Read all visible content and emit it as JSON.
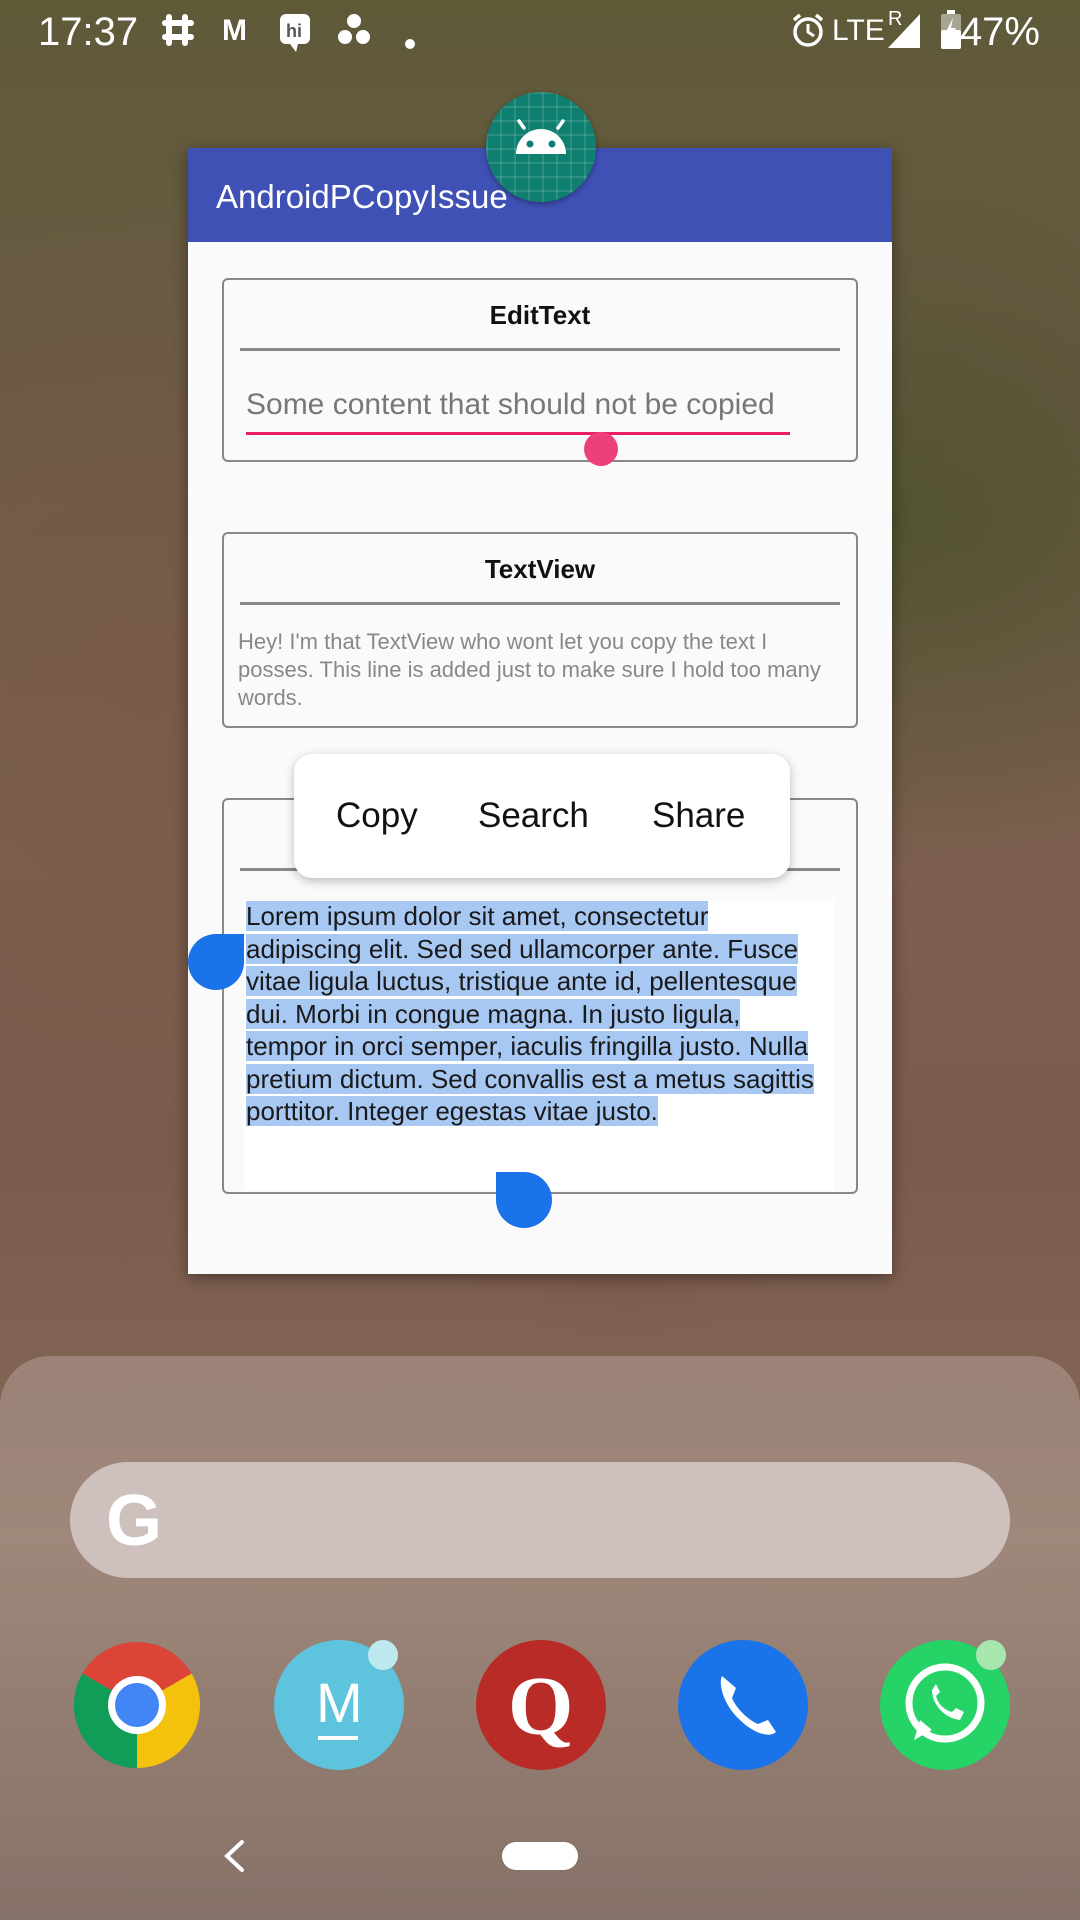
{
  "status_bar": {
    "time": "17:37",
    "notification_icons": [
      "slack-icon",
      "gmail-icon",
      "hike-icon",
      "dots-icon",
      "more-dot-icon"
    ],
    "gmail_label": "M",
    "alarm_icon": "alarm-icon",
    "network": "LTE",
    "roaming": "R",
    "battery_percent": "47%"
  },
  "app": {
    "title": "AndroidPCopyIssue",
    "edittext_card": {
      "title": "EditText",
      "field_value": "Some content that should not be copied"
    },
    "textview_card": {
      "title": "TextView",
      "body": "Hey! I'm that TextView who wont let you copy the text I posses. This line is added just to make sure I hold too many words."
    },
    "selection_card": {
      "text": "Lorem ipsum dolor sit amet, consectetur adipiscing elit. Sed sed ullamcorper ante. Fusce vitae ligula luctus, tristique ante id, pellentesque dui. Morbi in congue magna. In justo ligula, tempor in orci semper, iaculis fringilla justo. Nulla pretium dictum. Sed convallis est a metus sagittis porttitor. Integer egestas vitae justo."
    }
  },
  "context_menu": {
    "items": [
      "Copy",
      "Search",
      "Share"
    ]
  },
  "home": {
    "search_logo": "G",
    "dock_apps": [
      "Chrome",
      "M",
      "Q",
      "Phone",
      "WhatsApp"
    ]
  },
  "colors": {
    "app_bar": "#3f51b5",
    "selection": "#a8c8f4",
    "handle": "#1a73e8",
    "edit_accent": "#e91e63"
  }
}
